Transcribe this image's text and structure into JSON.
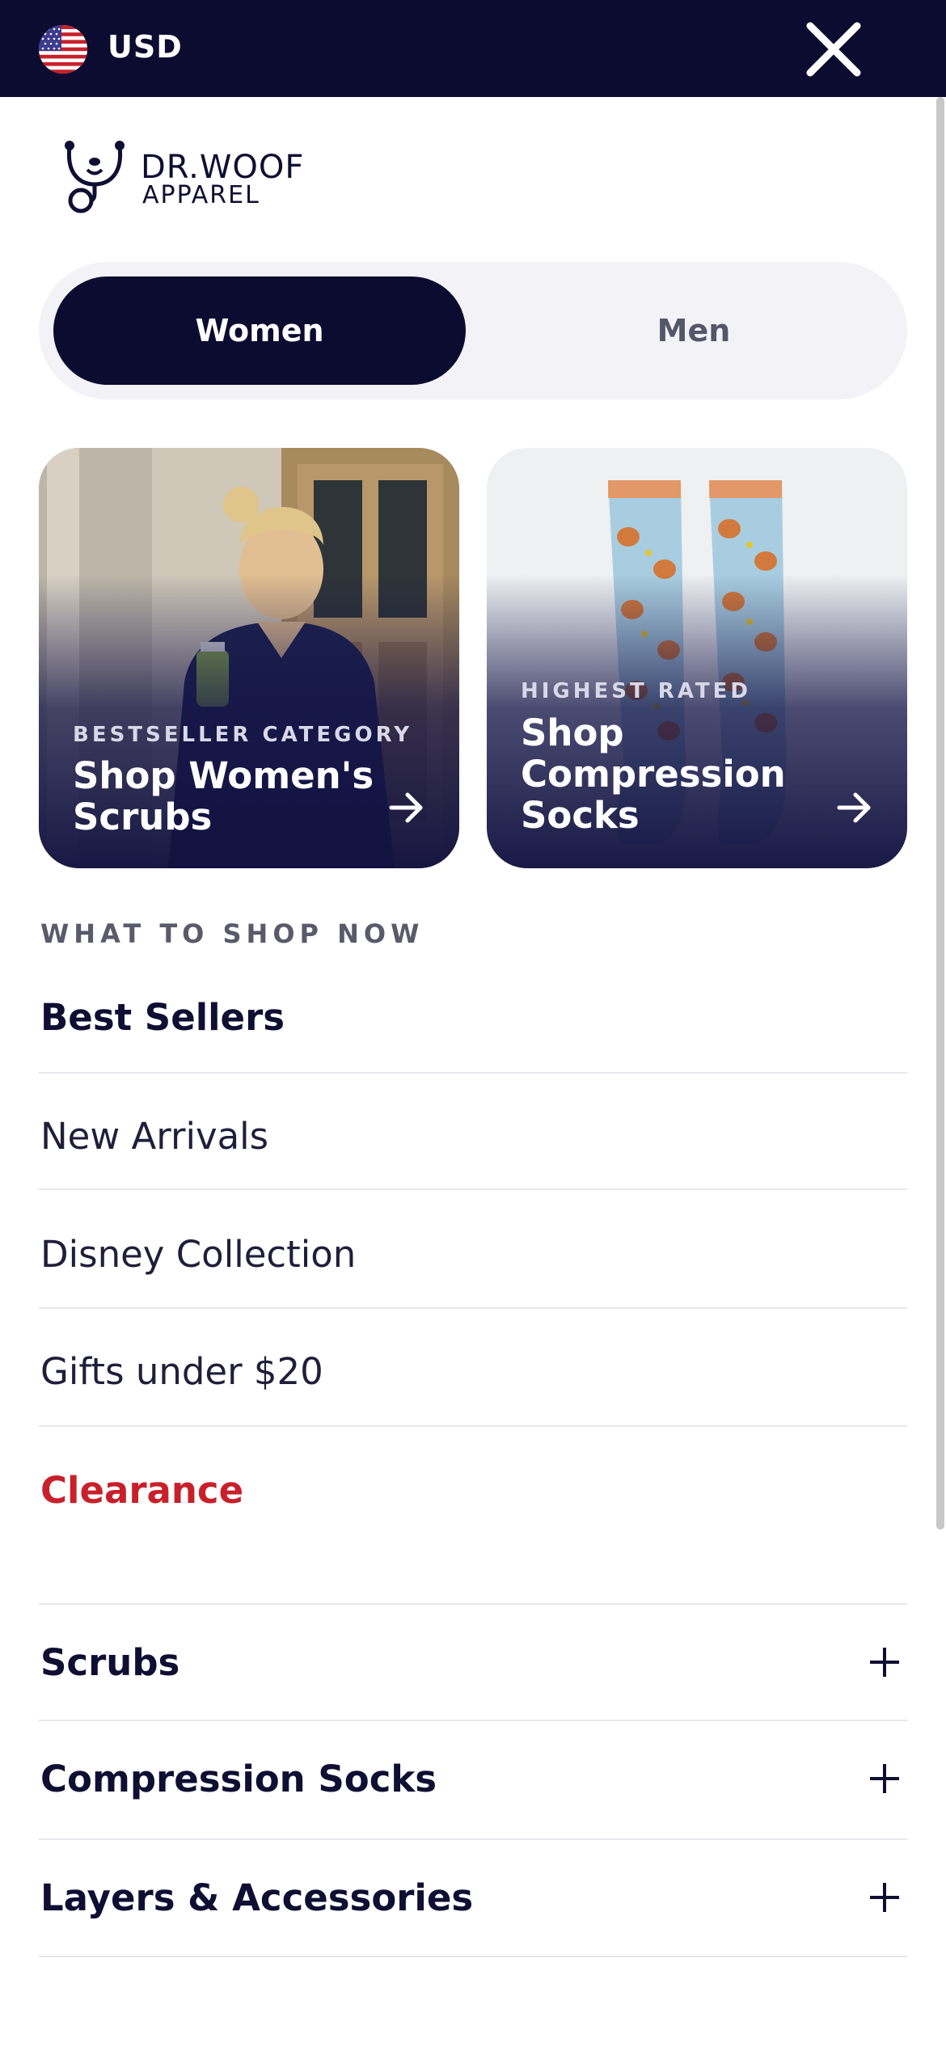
{
  "header": {
    "currency": "USD",
    "flag_icon": "us-flag-icon",
    "close_icon": "close-icon",
    "background": "#0c0c31"
  },
  "logo": {
    "line1": "DR.WOOF",
    "line2": "APPAREL"
  },
  "gender_toggle": {
    "options": [
      "Women",
      "Men"
    ],
    "selected": "Women"
  },
  "promo_cards": [
    {
      "eyebrow": "BESTSELLER CATEGORY",
      "title": "Shop Women's Scrubs",
      "icon": "arrow-right-icon"
    },
    {
      "eyebrow": "HIGHEST RATED",
      "title": "Shop Compression Socks",
      "icon": "arrow-right-icon"
    }
  ],
  "shop_now": {
    "label": "WHAT TO SHOP NOW",
    "links": [
      "Best Sellers",
      "New Arrivals",
      "Disney Collection",
      "Gifts under $20",
      "Clearance"
    ]
  },
  "categories": [
    "Scrubs",
    "Compression Socks",
    "Layers & Accessories"
  ],
  "colors": {
    "navy": "#0c0c31",
    "clearance_red": "#c8202a"
  }
}
